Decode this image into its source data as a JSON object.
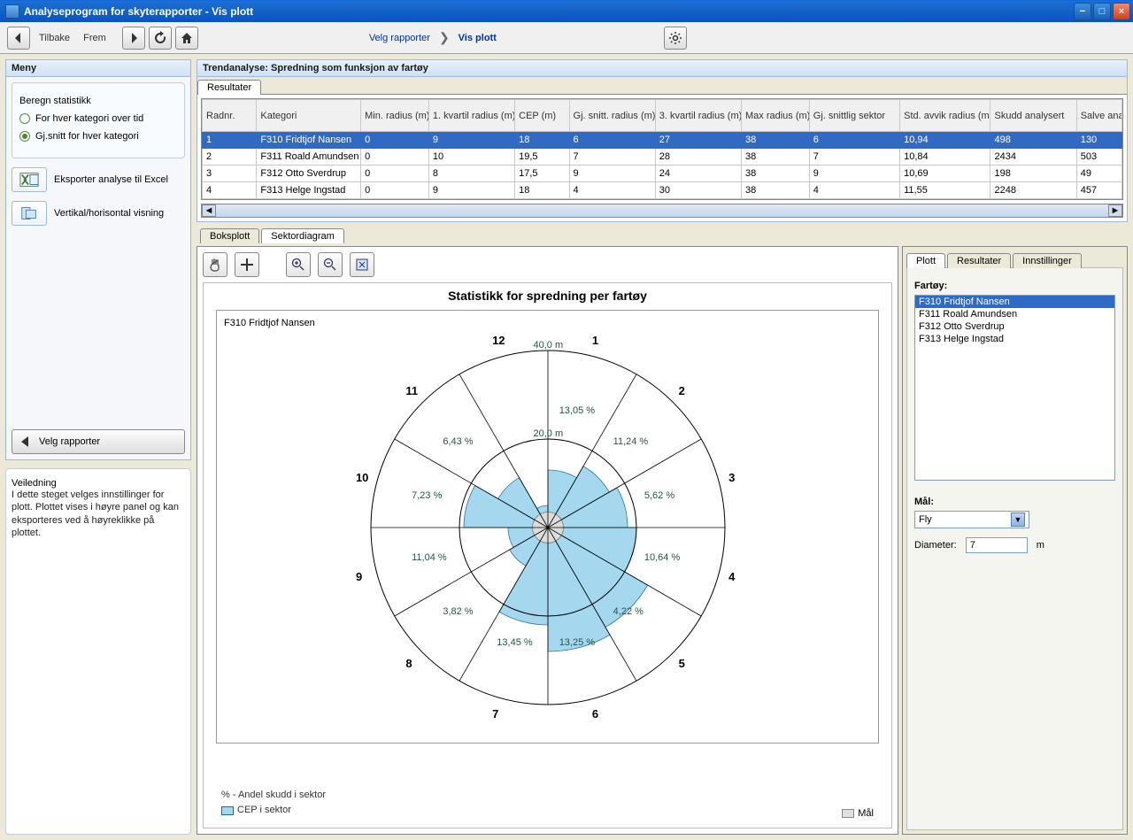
{
  "window": {
    "title": "Analyseprogram for skyterapporter - Vis plott"
  },
  "toolbar": {
    "back_label": "Tilbake",
    "forward_label": "Frem",
    "breadcrumb1": "Velg rapporter",
    "breadcrumb2": "Vis plott"
  },
  "left": {
    "menu_title": "Meny",
    "stats_legend": "Beregn statistikk",
    "radio1": "For hver kategori over tid",
    "radio2": "Gj.snitt for hver kategori",
    "export_label": "Eksporter analyse til Excel",
    "orient_label": "Vertikal/horisontal visning",
    "select_btn": "Velg rapporter",
    "guide_legend": "Veiledning",
    "guide_text": "I dette steget velges innstillinger for plott. Plottet vises i høyre panel og kan eksporteres ved å høyreklikke på plottet."
  },
  "trend": {
    "title": "Trendanalyse: Spredning som funksjon av fartøy",
    "tab_results": "Resultater",
    "columns": [
      "Radnr.",
      "Kategori",
      "Min. radius (m)",
      "1. kvartil radius (m)",
      "CEP (m)",
      "Gj. snitt. radius (m)",
      "3. kvartil radius (m)",
      "Max radius (m)",
      "Gj. snittlig sektor",
      "Std. avvik radius (m)",
      "Skudd analysert",
      "Salve analy"
    ],
    "rows": [
      [
        "1",
        "F310 Fridtjof Nansen",
        "0",
        "9",
        "18",
        "6",
        "27",
        "38",
        "6",
        "10,94",
        "498",
        "130"
      ],
      [
        "2",
        "F311 Roald Amundsen",
        "0",
        "10",
        "19,5",
        "7",
        "28",
        "38",
        "7",
        "10,84",
        "2434",
        "503"
      ],
      [
        "3",
        "F312 Otto Sverdrup",
        "0",
        "8",
        "17,5",
        "9",
        "24",
        "38",
        "9",
        "10,69",
        "198",
        "49"
      ],
      [
        "4",
        "F313 Helge Ingstad",
        "0",
        "9",
        "18",
        "4",
        "30",
        "38",
        "4",
        "11,55",
        "2248",
        "457"
      ]
    ]
  },
  "chart_tabs": {
    "boxplot": "Boksplott",
    "sector": "Sektordiagram"
  },
  "chart": {
    "title": "Statistikk for spredning per fartøy",
    "series_name": "F310 Fridtjof Nansen",
    "legend_pct": "% - Andel skudd i sektor",
    "legend_cep": "CEP i sektor",
    "legend_goal": "Mål",
    "ring_inner": "20,0 m",
    "ring_outer": "40,0 m"
  },
  "chart_data": {
    "type": "polar-bar",
    "title": "Statistikk for spredning per fartøy — F310 Fridtjof Nansen",
    "sector_labels": [
      "1",
      "2",
      "3",
      "4",
      "5",
      "6",
      "7",
      "8",
      "9",
      "10",
      "11",
      "12"
    ],
    "cep_m": [
      13,
      16,
      18,
      20,
      26,
      28,
      22,
      10,
      9,
      19,
      13,
      5
    ],
    "andel_pct_label": [
      "13,05 %",
      "11,24 %",
      "5,62 %",
      "10,64 %",
      "4,22 %",
      "13,25 %",
      "13,45 %",
      "3,82 %",
      "11,04 %",
      "7,23 %",
      "6,43 %",
      ""
    ],
    "rings_m": [
      20,
      40
    ],
    "max_radius_m": 40
  },
  "settings": {
    "tab_plot": "Plott",
    "tab_results": "Resultater",
    "tab_settings": "Innstillinger",
    "vessel_label": "Fartøy:",
    "vessels": [
      "F310 Fridtjof Nansen",
      "F311 Roald Amundsen",
      "F312 Otto Sverdrup",
      "F313 Helge Ingstad"
    ],
    "goal_label": "Mål:",
    "goal_value": "Fly",
    "diameter_label": "Diameter:",
    "diameter_value": "7",
    "diameter_unit": "m"
  }
}
